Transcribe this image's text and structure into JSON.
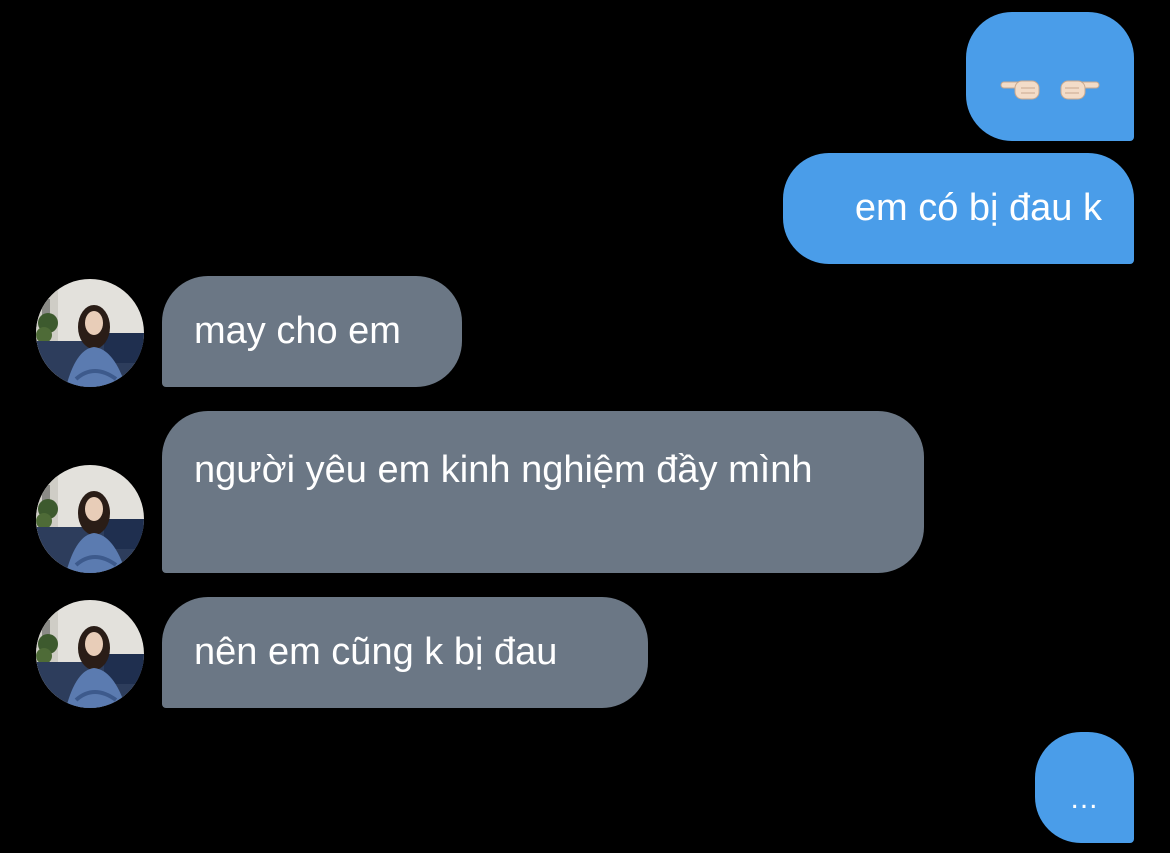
{
  "conversation": {
    "messages": [
      {
        "direction": "sent",
        "type": "emoji",
        "emojis": [
          "pointing-left-hand-icon",
          "pointing-right-hand-icon"
        ],
        "skin_tone": "#f3dcc8"
      },
      {
        "direction": "sent",
        "text": "em có bị đau k"
      },
      {
        "direction": "received",
        "text": "may cho em"
      },
      {
        "direction": "received",
        "text": "người yêu em kinh nghiệm đầy mình"
      },
      {
        "direction": "received",
        "text": "nên em cũng k bị đau"
      },
      {
        "direction": "sent",
        "text": "..."
      }
    ],
    "colors": {
      "background": "#000000",
      "sent_bubble": "#4a9de9",
      "received_bubble": "#6b7785",
      "text": "#ffffff"
    }
  }
}
